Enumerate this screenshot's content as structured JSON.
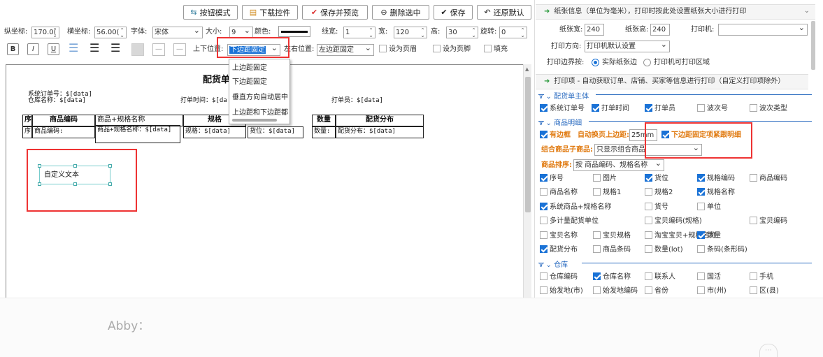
{
  "toolbar": {
    "buttons": [
      {
        "label": "按钮模式",
        "icon": "toggle-icon"
      },
      {
        "label": "下载控件",
        "icon": "document-icon"
      },
      {
        "label": "保存并预览",
        "icon": "check-icon"
      },
      {
        "label": "删除选中",
        "icon": "minus-circle-icon"
      },
      {
        "label": "保存",
        "icon": "check-icon"
      },
      {
        "label": "还原默认",
        "icon": "undo-icon"
      }
    ],
    "row2": {
      "y_label": "纵坐标:",
      "y_value": "170.0(",
      "x_label": "横坐标:",
      "x_value": "56.00(",
      "font_label": "字体:",
      "font_value": "宋体",
      "size_label": "大小:",
      "size_value": "9",
      "color_label": "颜色:",
      "linewidth_label": "线宽:",
      "linewidth_value": "1",
      "width_label": "宽:",
      "width_value": "120",
      "height_label": "高:",
      "height_value": "30",
      "rotate_label": "旋转:",
      "rotate_value": "0"
    },
    "row3": {
      "bold": "B",
      "italic": "I",
      "underline": "U",
      "vpos_label": "上下位置:",
      "vpos_value": "下边距固定",
      "hpos_label": "左右位置:",
      "hpos_value": "左边距固定",
      "header_label": "设为页眉",
      "footer_label": "设为页脚",
      "fill_label": "填充"
    }
  },
  "dropdown": {
    "items": [
      "上边距固定",
      "下边距固定",
      "垂直方向自动居中",
      "上边距和下边距都"
    ]
  },
  "canvas": {
    "title": "配货单",
    "order_no": "系统订单号：$[data]",
    "store_name": "仓库名称：$[data]",
    "print_time": "打单时间：$[da",
    "printer": "打单员：$[data]",
    "headers": [
      "序",
      "商品编码",
      "商品+规格名称",
      "规格",
      "",
      "数量",
      "配货分布"
    ],
    "row": [
      "序",
      "商品编码:",
      "商品+规格名称：$[data]",
      "规格：$[data]",
      "货位：$[data]",
      "数量:",
      "配货分布：$[data]"
    ],
    "custom_text": "自定义文本"
  },
  "chat": {
    "text": "Abby："
  },
  "panel": {
    "paper_section": "纸张信息（单位为毫米），打印时按此处设置纸张大小进行打印",
    "paper_width_label": "纸张宽:",
    "paper_width": "240",
    "paper_height_label": "纸张高:",
    "paper_height": "240",
    "printer_label": "打印机:",
    "printer_value": "",
    "direction_label": "打印方向:",
    "direction_value": "打印机默认设置",
    "border_label": "打印边界按:",
    "border_opt1": "实际纸张边",
    "border_opt2": "打印机可打印区域",
    "items_section": "打印项 - 自动获取订单、店铺、买家等信息进行打印（自定义打印项除外）",
    "group1": "配货单主体",
    "group1_items": [
      {
        "label": "系统订单号",
        "checked": true
      },
      {
        "label": "打单时间",
        "checked": true
      },
      {
        "label": "打单员",
        "checked": true
      },
      {
        "label": "波次号",
        "checked": false
      },
      {
        "label": "波次类型",
        "checked": false
      }
    ],
    "group2": "商品明细",
    "border_cb": "有边框",
    "auto_margin_label": "自动换页上边距:",
    "auto_margin_value": "25mm",
    "follow_cb": "下边距固定项紧跟明细",
    "combo_label": "组合商品子商品:",
    "combo_value": "只显示组合商品",
    "sort_label": "商品排序:",
    "sort_value": "按 商品编码、规格名称",
    "grid_items": [
      [
        {
          "label": "序号",
          "checked": true
        },
        {
          "label": "图片",
          "checked": false
        },
        {
          "label": "货位",
          "checked": true
        },
        {
          "label": "规格编码",
          "checked": true
        },
        {
          "label": "商品编码",
          "checked": false
        }
      ],
      [
        {
          "label": "商品名称",
          "checked": false
        },
        {
          "label": "规格1",
          "checked": false
        },
        {
          "label": "规格2",
          "checked": false
        },
        {
          "label": "规格名称",
          "checked": true
        }
      ],
      [
        {
          "label": "系统商品+规格名称",
          "checked": true
        },
        {
          "label": "货号",
          "checked": false
        },
        {
          "label": "单位",
          "checked": false
        }
      ],
      [
        {
          "label": "多计量配货单位",
          "checked": false
        },
        {
          "label": "宝贝编码(规格)",
          "checked": false
        },
        {
          "label": "宝贝编码",
          "checked": false
        }
      ],
      [
        {
          "label": "宝贝名称",
          "checked": false
        },
        {
          "label": "宝贝规格",
          "checked": false
        },
        {
          "label": "淘宝宝贝+规格名称",
          "checked": false
        },
        {
          "label": "数量",
          "checked": true
        }
      ],
      [
        {
          "label": "配货分布",
          "checked": true
        },
        {
          "label": "商品条码",
          "checked": false
        },
        {
          "label": "数量(lot)",
          "checked": false
        },
        {
          "label": "条码(条形码)",
          "checked": false
        }
      ]
    ],
    "group3": "仓库",
    "warehouse_items": [
      [
        {
          "label": "仓库编码",
          "checked": false
        },
        {
          "label": "仓库名称",
          "checked": true
        },
        {
          "label": "联系人",
          "checked": false
        },
        {
          "label": "国活",
          "checked": false
        },
        {
          "label": "手机",
          "checked": false
        }
      ],
      [
        {
          "label": "始发地(市)",
          "checked": false
        },
        {
          "label": "始发地编码",
          "checked": false
        },
        {
          "label": "省份",
          "checked": false
        },
        {
          "label": "市(州)",
          "checked": false
        },
        {
          "label": "区(县)",
          "checked": false
        }
      ]
    ]
  },
  "colors": {
    "accent": "#1a72d6",
    "red": "#e33333",
    "orange": "#e07a10",
    "green": "#2b9a3d",
    "group_blue": "#2a6bc0"
  }
}
